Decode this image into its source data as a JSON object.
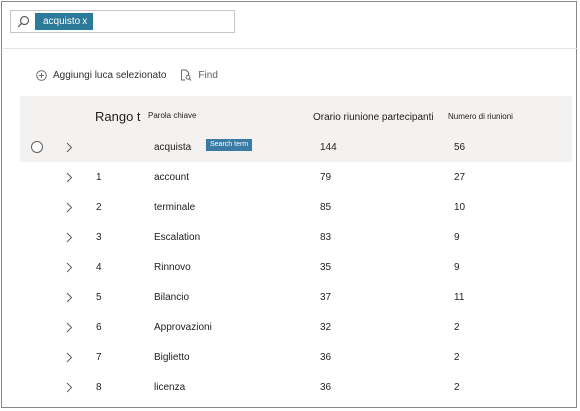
{
  "search": {
    "token": "acquisto",
    "remove_glyph": "x"
  },
  "toolbar": {
    "add_label": "Aggiungi luca selezionato",
    "find_label": "Find"
  },
  "table": {
    "columns": {
      "rank": "Rango t",
      "keyword": "Parola chiave",
      "hours": "Orario riunione partecipanti",
      "count": "Numero di riunioni"
    },
    "rows": [
      {
        "rank": "",
        "keyword": "acquista",
        "badge": "Search term",
        "hours": "144",
        "count": "56"
      },
      {
        "rank": "1",
        "keyword": "account",
        "hours": "79",
        "count": "27"
      },
      {
        "rank": "2",
        "keyword": "terminale",
        "hours": "85",
        "count": "10"
      },
      {
        "rank": "3",
        "keyword": "Escalation",
        "hours": "83",
        "count": "9"
      },
      {
        "rank": "4",
        "keyword": "Rinnovo",
        "hours": "35",
        "count": "9"
      },
      {
        "rank": "5",
        "keyword": "Bilancio",
        "hours": "37",
        "count": "11"
      },
      {
        "rank": "6",
        "keyword": "Approvazioni",
        "hours": "32",
        "count": "2"
      },
      {
        "rank": "7",
        "keyword": "Biglietto",
        "hours": "36",
        "count": "2"
      },
      {
        "rank": "8",
        "keyword": "licenza",
        "hours": "36",
        "count": "2"
      }
    ]
  },
  "colors": {
    "accent": "#2b7a99",
    "badge": "#3a7ba4",
    "row_selected": "#f3f2f1"
  },
  "icons": {
    "search": "search-icon",
    "add": "add-circle-icon",
    "find": "find-icon",
    "expand": "chevron-right-icon"
  }
}
